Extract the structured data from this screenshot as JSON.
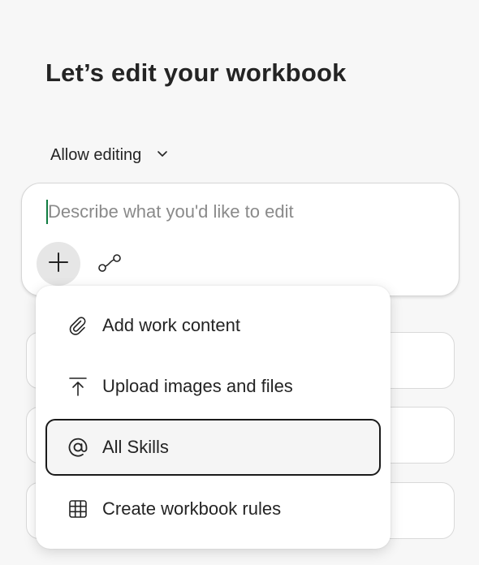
{
  "header": {
    "title": "Let’s edit your workbook"
  },
  "mode": {
    "label": "Allow editing",
    "icon": "chevron-down-icon"
  },
  "composer": {
    "placeholder": "Describe what you'd like to edit",
    "value": "",
    "attach_icon": "plus-icon",
    "flow_icon": "flow-icon"
  },
  "menu": {
    "items": [
      {
        "label": "Add work content",
        "icon": "paperclip-icon"
      },
      {
        "label": "Upload images and files",
        "icon": "upload-icon"
      },
      {
        "label": "All Skills",
        "icon": "at-sign-icon",
        "focused": true
      },
      {
        "label": "Create workbook rules",
        "icon": "table-grid-icon"
      }
    ]
  },
  "colors": {
    "background": "#f7f7f7",
    "caret": "#107c41",
    "text": "#242424",
    "placeholder": "#8a8a8a"
  }
}
